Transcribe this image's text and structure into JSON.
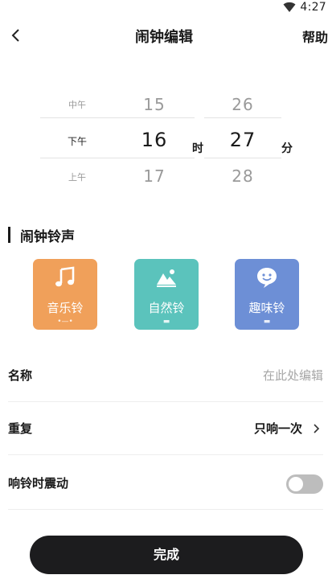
{
  "status_bar": {
    "time": "4:27",
    "wifi_icon": "wifi-icon"
  },
  "header": {
    "back_icon": "chevron-left-icon",
    "title": "闹钟编辑",
    "help_label": "帮助"
  },
  "time_picker": {
    "period": {
      "above": "中午",
      "selected": "下午",
      "below": "上午"
    },
    "hour": {
      "above": "15",
      "selected": "16",
      "below": "17"
    },
    "minute": {
      "above": "26",
      "selected": "27",
      "below": "28"
    },
    "hour_unit": "时",
    "minute_unit": "分"
  },
  "ringtone_section": {
    "title": "闹钟铃声",
    "cards": [
      {
        "label": "音乐铃",
        "icon": "music-note-icon",
        "color": "#F0A05A"
      },
      {
        "label": "自然铃",
        "icon": "mountain-icon",
        "color": "#5BC3BC"
      },
      {
        "label": "趣味铃",
        "icon": "smiley-chat-icon",
        "color": "#6D8FD6"
      }
    ]
  },
  "settings": {
    "name": {
      "label": "名称",
      "value": "",
      "placeholder": "在此处编辑"
    },
    "repeat": {
      "label": "重复",
      "value": "只响一次",
      "icon": "chevron-right-icon"
    },
    "vibrate": {
      "label": "响铃时震动",
      "enabled": false,
      "off_color": "#BDBDBD"
    }
  },
  "done_button": {
    "label": "完成",
    "color": "#1C1C1E"
  }
}
